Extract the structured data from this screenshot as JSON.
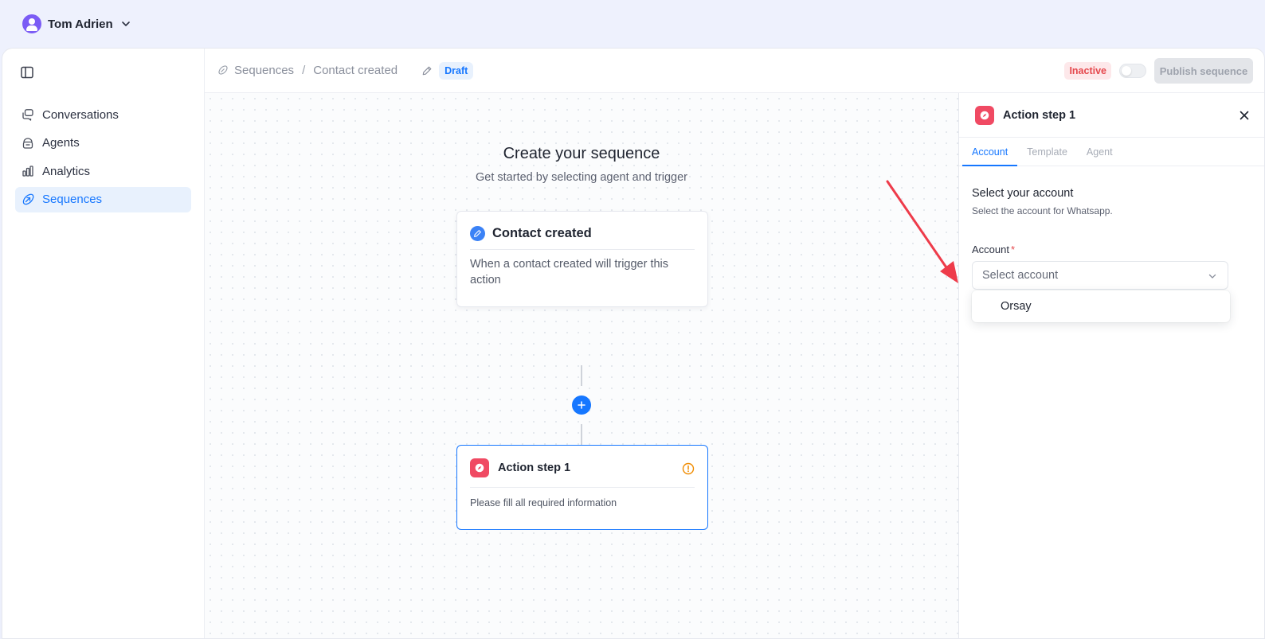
{
  "user": {
    "name": "Tom Adrien"
  },
  "sidebar": {
    "items": [
      {
        "label": "Conversations",
        "icon": "chat-icon",
        "active": false
      },
      {
        "label": "Agents",
        "icon": "agent-icon",
        "active": false
      },
      {
        "label": "Analytics",
        "icon": "analytics-icon",
        "active": false
      },
      {
        "label": "Sequences",
        "icon": "sequence-icon",
        "active": true
      }
    ]
  },
  "header": {
    "breadcrumb": {
      "root": "Sequences",
      "separator": "/",
      "current": "Contact created"
    },
    "draft_label": "Draft",
    "status_label": "Inactive",
    "publish_label": "Publish sequence"
  },
  "canvas": {
    "title": "Create your sequence",
    "subtitle": "Get started by selecting agent and trigger",
    "trigger": {
      "title": "Contact created",
      "description": "When a contact created will trigger this action"
    },
    "action": {
      "title": "Action step 1",
      "description": "Please fill all required information"
    }
  },
  "panel": {
    "title": "Action step 1",
    "tabs": [
      "Account",
      "Template",
      "Agent"
    ],
    "active_tab": "Account",
    "section_title": "Select your account",
    "section_subtitle": "Select the account for Whatsapp.",
    "field_label": "Account",
    "required_mark": "*",
    "select_placeholder": "Select account",
    "options": [
      "Orsay"
    ]
  },
  "colors": {
    "accent": "#1677ff",
    "danger": "#e5484d",
    "app_icon": "#f04a63",
    "warning": "#f08c00",
    "annotation_arrow": "#ee3b4a"
  }
}
